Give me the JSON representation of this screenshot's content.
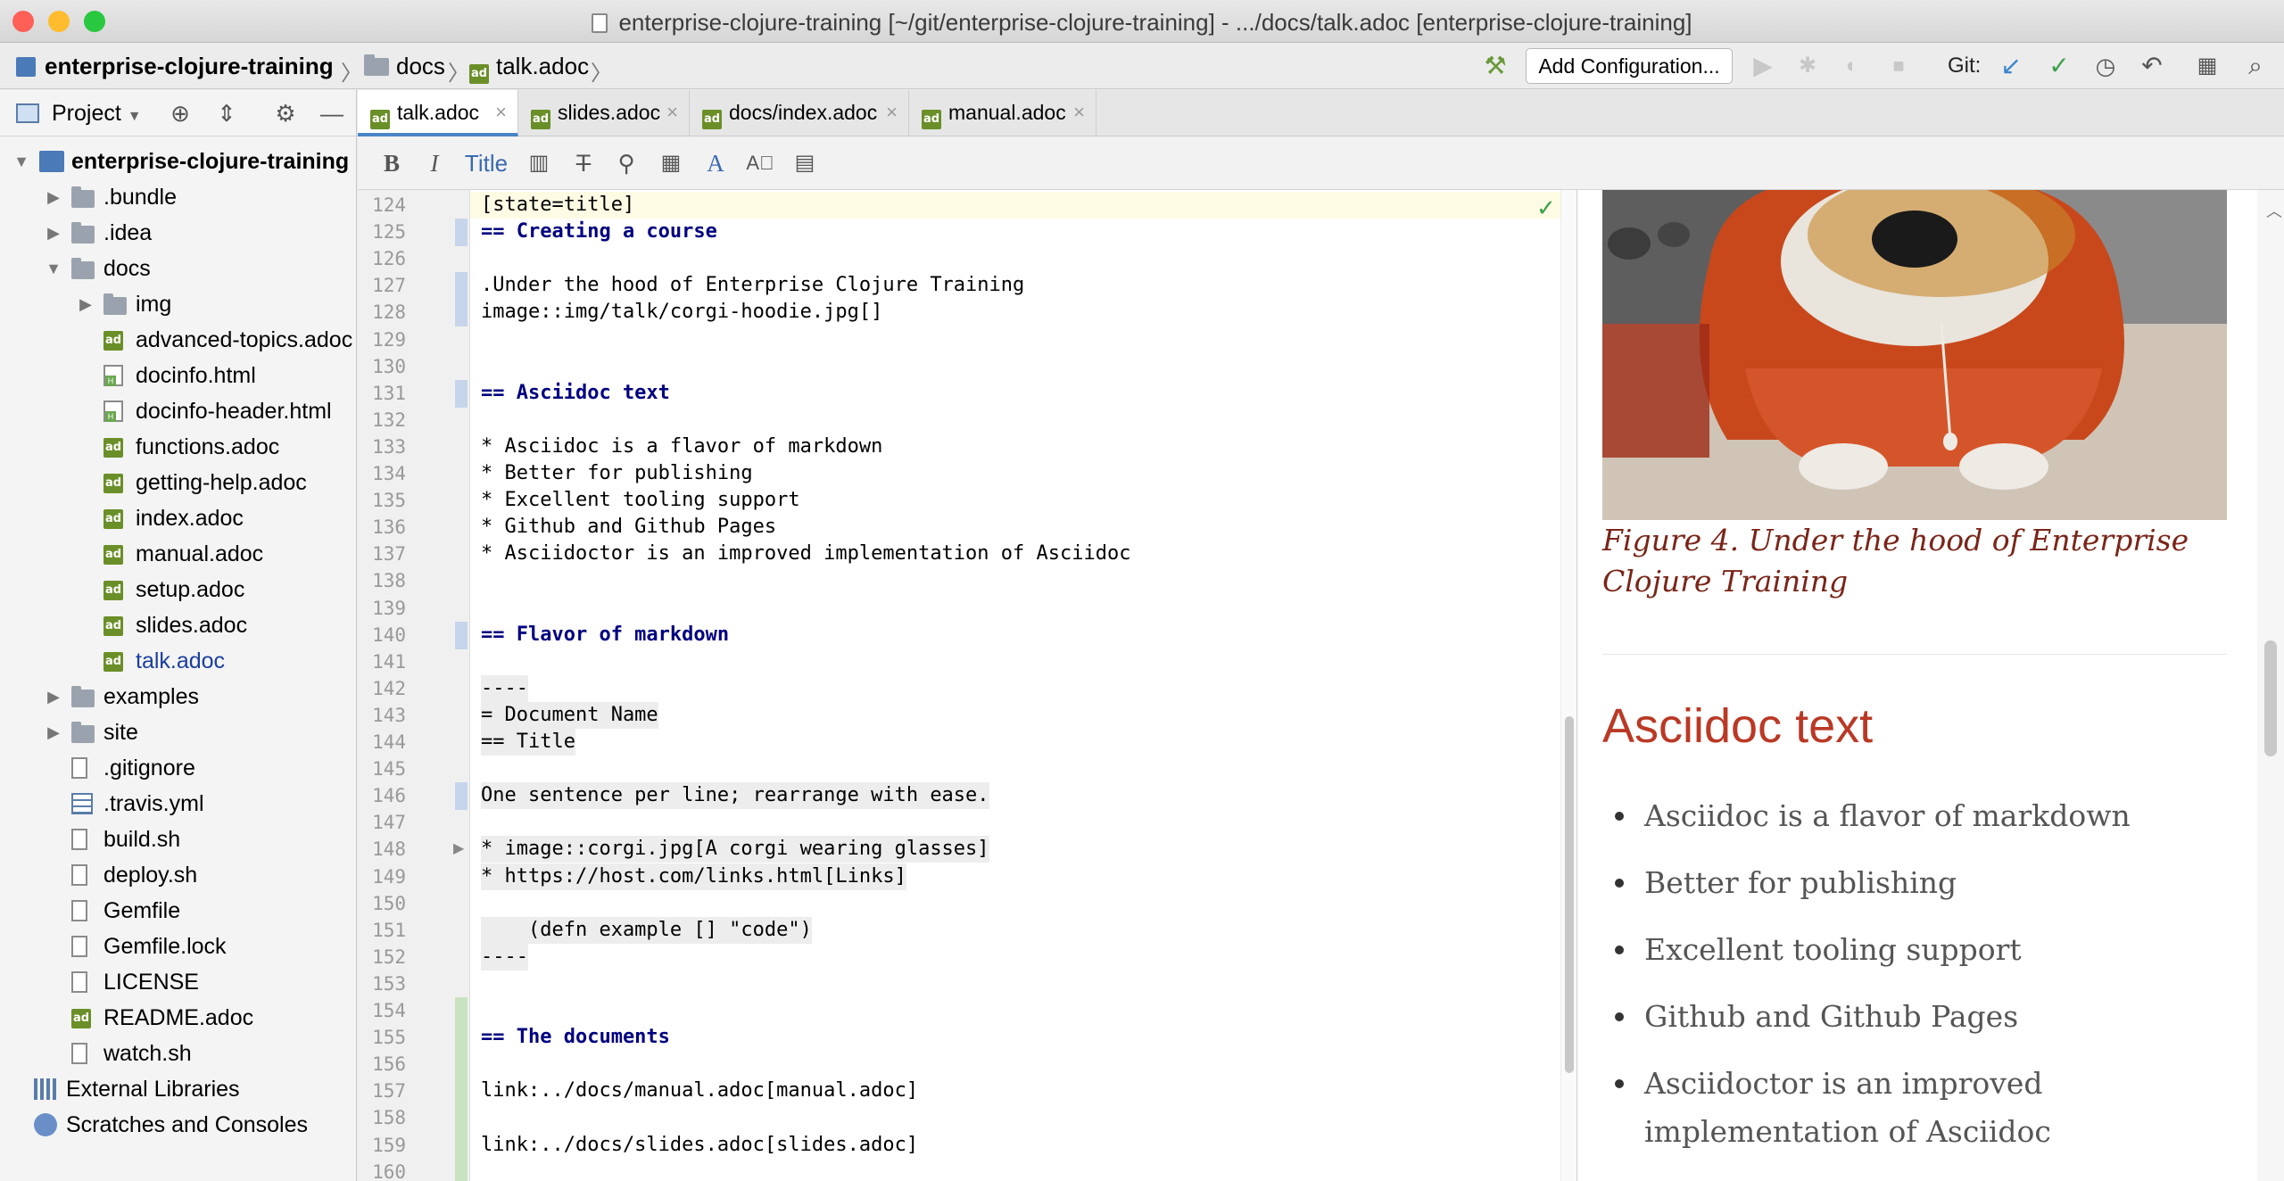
{
  "window": {
    "title": "enterprise-clojure-training [~/git/enterprise-clojure-training] - .../docs/talk.adoc [enterprise-clojure-training]",
    "traffic_colors": [
      "#fe5f57",
      "#febc2e",
      "#28c840"
    ]
  },
  "navbar": {
    "crumbs": [
      "enterprise-clojure-training",
      "docs",
      "talk.adoc"
    ],
    "add_configuration": "Add Configuration...",
    "git_label": "Git:"
  },
  "project": {
    "title": "Project",
    "tree": [
      {
        "label": "enterprise-clojure-training",
        "type": "module",
        "expanded": true
      },
      {
        "label": ".bundle",
        "type": "folder"
      },
      {
        "label": ".idea",
        "type": "folder"
      },
      {
        "label": "docs",
        "type": "folder",
        "expanded": true
      },
      {
        "label": "img",
        "type": "folder"
      },
      {
        "label": "advanced-topics.adoc",
        "type": "adoc"
      },
      {
        "label": "docinfo.html",
        "type": "html"
      },
      {
        "label": "docinfo-header.html",
        "type": "html"
      },
      {
        "label": "functions.adoc",
        "type": "adoc"
      },
      {
        "label": "getting-help.adoc",
        "type": "adoc"
      },
      {
        "label": "index.adoc",
        "type": "adoc"
      },
      {
        "label": "manual.adoc",
        "type": "adoc"
      },
      {
        "label": "setup.adoc",
        "type": "adoc"
      },
      {
        "label": "slides.adoc",
        "type": "adoc"
      },
      {
        "label": "talk.adoc",
        "type": "adoc",
        "selected": true
      },
      {
        "label": "examples",
        "type": "folder"
      },
      {
        "label": "site",
        "type": "folder"
      },
      {
        "label": ".gitignore",
        "type": "file"
      },
      {
        "label": ".travis.yml",
        "type": "table"
      },
      {
        "label": "build.sh",
        "type": "file"
      },
      {
        "label": "deploy.sh",
        "type": "file"
      },
      {
        "label": "Gemfile",
        "type": "file"
      },
      {
        "label": "Gemfile.lock",
        "type": "file"
      },
      {
        "label": "LICENSE",
        "type": "file"
      },
      {
        "label": "README.adoc",
        "type": "adoc"
      },
      {
        "label": "watch.sh",
        "type": "file"
      },
      {
        "label": "External Libraries",
        "type": "lib"
      },
      {
        "label": "Scratches and Consoles",
        "type": "scratch"
      }
    ]
  },
  "tabs": [
    "talk.adoc",
    "slides.adoc",
    "docs/index.adoc",
    "manual.adoc"
  ],
  "adoc_toolbar": {
    "title_label": "Title"
  },
  "editor": {
    "lines": [
      {
        "n": "124",
        "text": "[state=title]"
      },
      {
        "n": "125",
        "text": "== Creating a course"
      },
      {
        "n": "126",
        "text": ""
      },
      {
        "n": "127",
        "text": ".Under the hood of Enterprise Clojure Training"
      },
      {
        "n": "128",
        "text": "image::img/talk/corgi-hoodie.jpg[]"
      },
      {
        "n": "129",
        "text": ""
      },
      {
        "n": "130",
        "text": ""
      },
      {
        "n": "131",
        "text": "== Asciidoc text"
      },
      {
        "n": "132",
        "text": ""
      },
      {
        "n": "133",
        "text": "* Asciidoc is a flavor of markdown"
      },
      {
        "n": "134",
        "text": "* Better for publishing"
      },
      {
        "n": "135",
        "text": "* Excellent tooling support"
      },
      {
        "n": "136",
        "text": "* Github and Github Pages"
      },
      {
        "n": "137",
        "text": "* Asciidoctor is an improved implementation of Asciidoc"
      },
      {
        "n": "138",
        "text": ""
      },
      {
        "n": "139",
        "text": ""
      },
      {
        "n": "140",
        "text": "== Flavor of markdown"
      },
      {
        "n": "141",
        "text": ""
      },
      {
        "n": "142",
        "text": "----"
      },
      {
        "n": "143",
        "text": "= Document Name"
      },
      {
        "n": "144",
        "text": "== Title"
      },
      {
        "n": "145",
        "text": ""
      },
      {
        "n": "146",
        "text": "One sentence per line; rearrange with ease."
      },
      {
        "n": "147",
        "text": ""
      },
      {
        "n": "148",
        "text": "* image::corgi.jpg[A corgi wearing glasses]"
      },
      {
        "n": "149",
        "text": "* https://host.com/links.html[Links]"
      },
      {
        "n": "150",
        "text": ""
      },
      {
        "n": "151",
        "text": "    (defn example [] \"code\")"
      },
      {
        "n": "152",
        "text": "----"
      },
      {
        "n": "153",
        "text": ""
      },
      {
        "n": "154",
        "text": ""
      },
      {
        "n": "155",
        "text": "== The documents"
      },
      {
        "n": "156",
        "text": ""
      },
      {
        "n": "157",
        "text": "link:../docs/manual.adoc[manual.adoc]"
      },
      {
        "n": "158",
        "text": ""
      },
      {
        "n": "159",
        "text": "link:../docs/slides.adoc[slides.adoc]"
      },
      {
        "n": "160",
        "text": ""
      }
    ]
  },
  "preview": {
    "figure_caption": "Figure 4. Under the hood of Enterprise Clojure Training",
    "section_title": "Asciidoc text",
    "bullets": [
      "Asciidoc is a flavor of markdown",
      "Better for publishing",
      "Excellent tooling support",
      "Github and Github Pages",
      "Asciidoctor is an improved implementation of Asciidoc"
    ],
    "heading_color": "#ba3925",
    "caption_color": "#7a2518"
  }
}
